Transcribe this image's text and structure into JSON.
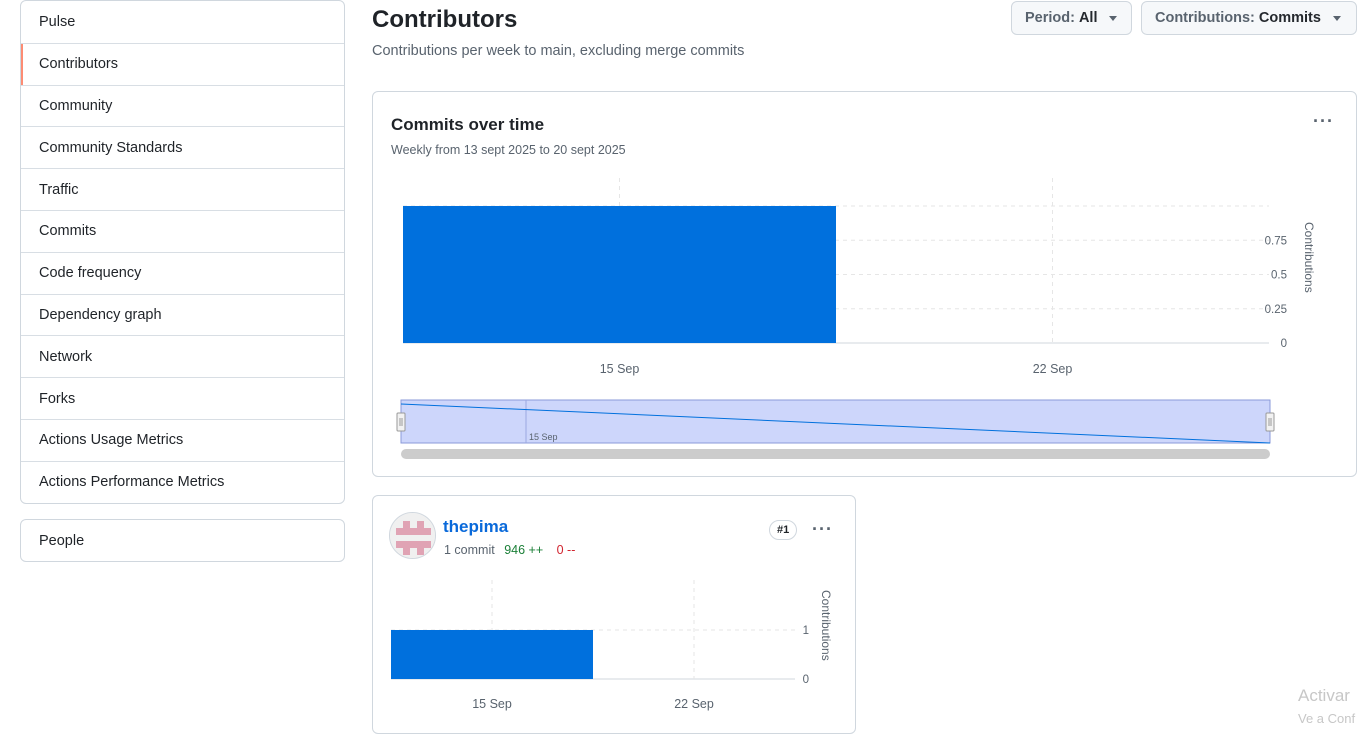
{
  "sidebar": {
    "items": [
      {
        "label": "Pulse"
      },
      {
        "label": "Contributors"
      },
      {
        "label": "Community"
      },
      {
        "label": "Community Standards"
      },
      {
        "label": "Traffic"
      },
      {
        "label": "Commits"
      },
      {
        "label": "Code frequency"
      },
      {
        "label": "Dependency graph"
      },
      {
        "label": "Network"
      },
      {
        "label": "Forks"
      },
      {
        "label": "Actions Usage Metrics"
      },
      {
        "label": "Actions Performance Metrics"
      }
    ],
    "selected": "Contributors",
    "people_label": "People"
  },
  "header": {
    "title": "Contributors",
    "subtitle": "Contributions per week to main, excluding merge commits",
    "period_prefix": "Period:",
    "period_value": "All",
    "contrib_prefix": "Contributions:",
    "contrib_value": "Commits"
  },
  "main_chart": {
    "title": "Commits over time",
    "subtitle": "Weekly from 13 sept 2025 to 20 sept 2025",
    "ellipsis": "···"
  },
  "contributor": {
    "name": "thepima",
    "commits": "1 commit",
    "additions": "946 ++",
    "deletions": "0 --",
    "rank": "#1",
    "ellipsis": "···"
  },
  "watermark": {
    "line1": "Activar",
    "line2": "Ve a Conf"
  },
  "colors": {
    "bar": "#0070dd",
    "navigator_fill": "#cdd6fb",
    "selected_indicator": "#fd8c73",
    "link": "#0969da"
  },
  "chart_data": [
    {
      "type": "bar",
      "categories": [
        "15 Sep",
        "22 Sep"
      ],
      "values": [
        1,
        0
      ],
      "x_ticks": [
        "15 Sep",
        "22 Sep"
      ],
      "y_ticks": [
        "0",
        "0.25",
        "0.5",
        "0.75"
      ],
      "ylabel": "Contributions",
      "ylim": [
        0,
        1
      ],
      "navigator_label": "15 Sep",
      "grid": true
    },
    {
      "type": "bar",
      "categories": [
        "15 Sep",
        "22 Sep"
      ],
      "values": [
        1,
        0
      ],
      "x_ticks": [
        "15 Sep",
        "22 Sep"
      ],
      "y_ticks": [
        "0",
        "1"
      ],
      "ylabel": "Contributions",
      "ylim": [
        0,
        1
      ],
      "grid": true
    }
  ]
}
